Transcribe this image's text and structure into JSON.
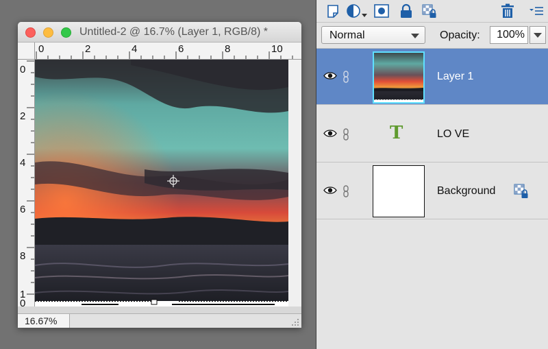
{
  "document": {
    "title": "Untitled-2 @ 16.7% (Layer 1, RGB/8) *",
    "ruler_top_labels": [
      "0",
      "2",
      "4",
      "6",
      "8",
      "10"
    ],
    "ruler_left_labels": [
      "0",
      "2",
      "4",
      "6",
      "8",
      "1\n0"
    ],
    "zoom": "16.67%"
  },
  "panel": {
    "toolbar": {
      "icons": [
        "new-layer-icon",
        "adjustment-layer-icon",
        "layer-mask-icon",
        "lock-all-icon",
        "lock-transparency-icon",
        "trash-icon",
        "panel-menu-icon"
      ]
    },
    "blend_mode": "Normal",
    "opacity_label": "Opacity:",
    "opacity_value": "100%",
    "layers": [
      {
        "name": "Layer 1",
        "type": "image",
        "selected": true
      },
      {
        "name": "LO VE",
        "type": "text",
        "glyph": "T",
        "selected": false
      },
      {
        "name": "Background",
        "type": "background",
        "locked": true,
        "selected": false
      }
    ]
  },
  "colors": {
    "selection": "#5f87c6",
    "text_layer_glyph": "#5f9a2e",
    "panel_bg": "#e4e4e4"
  }
}
